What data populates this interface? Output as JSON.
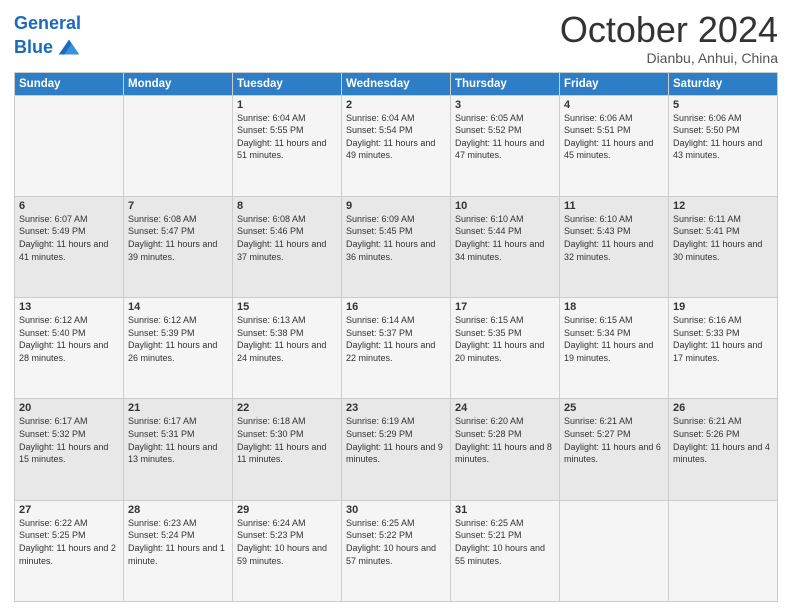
{
  "header": {
    "logo_line1": "General",
    "logo_line2": "Blue",
    "month": "October 2024",
    "location": "Dianbu, Anhui, China"
  },
  "weekdays": [
    "Sunday",
    "Monday",
    "Tuesday",
    "Wednesday",
    "Thursday",
    "Friday",
    "Saturday"
  ],
  "weeks": [
    [
      {
        "day": "",
        "sunrise": "",
        "sunset": "",
        "daylight": ""
      },
      {
        "day": "",
        "sunrise": "",
        "sunset": "",
        "daylight": ""
      },
      {
        "day": "1",
        "sunrise": "Sunrise: 6:04 AM",
        "sunset": "Sunset: 5:55 PM",
        "daylight": "Daylight: 11 hours and 51 minutes."
      },
      {
        "day": "2",
        "sunrise": "Sunrise: 6:04 AM",
        "sunset": "Sunset: 5:54 PM",
        "daylight": "Daylight: 11 hours and 49 minutes."
      },
      {
        "day": "3",
        "sunrise": "Sunrise: 6:05 AM",
        "sunset": "Sunset: 5:52 PM",
        "daylight": "Daylight: 11 hours and 47 minutes."
      },
      {
        "day": "4",
        "sunrise": "Sunrise: 6:06 AM",
        "sunset": "Sunset: 5:51 PM",
        "daylight": "Daylight: 11 hours and 45 minutes."
      },
      {
        "day": "5",
        "sunrise": "Sunrise: 6:06 AM",
        "sunset": "Sunset: 5:50 PM",
        "daylight": "Daylight: 11 hours and 43 minutes."
      }
    ],
    [
      {
        "day": "6",
        "sunrise": "Sunrise: 6:07 AM",
        "sunset": "Sunset: 5:49 PM",
        "daylight": "Daylight: 11 hours and 41 minutes."
      },
      {
        "day": "7",
        "sunrise": "Sunrise: 6:08 AM",
        "sunset": "Sunset: 5:47 PM",
        "daylight": "Daylight: 11 hours and 39 minutes."
      },
      {
        "day": "8",
        "sunrise": "Sunrise: 6:08 AM",
        "sunset": "Sunset: 5:46 PM",
        "daylight": "Daylight: 11 hours and 37 minutes."
      },
      {
        "day": "9",
        "sunrise": "Sunrise: 6:09 AM",
        "sunset": "Sunset: 5:45 PM",
        "daylight": "Daylight: 11 hours and 36 minutes."
      },
      {
        "day": "10",
        "sunrise": "Sunrise: 6:10 AM",
        "sunset": "Sunset: 5:44 PM",
        "daylight": "Daylight: 11 hours and 34 minutes."
      },
      {
        "day": "11",
        "sunrise": "Sunrise: 6:10 AM",
        "sunset": "Sunset: 5:43 PM",
        "daylight": "Daylight: 11 hours and 32 minutes."
      },
      {
        "day": "12",
        "sunrise": "Sunrise: 6:11 AM",
        "sunset": "Sunset: 5:41 PM",
        "daylight": "Daylight: 11 hours and 30 minutes."
      }
    ],
    [
      {
        "day": "13",
        "sunrise": "Sunrise: 6:12 AM",
        "sunset": "Sunset: 5:40 PM",
        "daylight": "Daylight: 11 hours and 28 minutes."
      },
      {
        "day": "14",
        "sunrise": "Sunrise: 6:12 AM",
        "sunset": "Sunset: 5:39 PM",
        "daylight": "Daylight: 11 hours and 26 minutes."
      },
      {
        "day": "15",
        "sunrise": "Sunrise: 6:13 AM",
        "sunset": "Sunset: 5:38 PM",
        "daylight": "Daylight: 11 hours and 24 minutes."
      },
      {
        "day": "16",
        "sunrise": "Sunrise: 6:14 AM",
        "sunset": "Sunset: 5:37 PM",
        "daylight": "Daylight: 11 hours and 22 minutes."
      },
      {
        "day": "17",
        "sunrise": "Sunrise: 6:15 AM",
        "sunset": "Sunset: 5:35 PM",
        "daylight": "Daylight: 11 hours and 20 minutes."
      },
      {
        "day": "18",
        "sunrise": "Sunrise: 6:15 AM",
        "sunset": "Sunset: 5:34 PM",
        "daylight": "Daylight: 11 hours and 19 minutes."
      },
      {
        "day": "19",
        "sunrise": "Sunrise: 6:16 AM",
        "sunset": "Sunset: 5:33 PM",
        "daylight": "Daylight: 11 hours and 17 minutes."
      }
    ],
    [
      {
        "day": "20",
        "sunrise": "Sunrise: 6:17 AM",
        "sunset": "Sunset: 5:32 PM",
        "daylight": "Daylight: 11 hours and 15 minutes."
      },
      {
        "day": "21",
        "sunrise": "Sunrise: 6:17 AM",
        "sunset": "Sunset: 5:31 PM",
        "daylight": "Daylight: 11 hours and 13 minutes."
      },
      {
        "day": "22",
        "sunrise": "Sunrise: 6:18 AM",
        "sunset": "Sunset: 5:30 PM",
        "daylight": "Daylight: 11 hours and 11 minutes."
      },
      {
        "day": "23",
        "sunrise": "Sunrise: 6:19 AM",
        "sunset": "Sunset: 5:29 PM",
        "daylight": "Daylight: 11 hours and 9 minutes."
      },
      {
        "day": "24",
        "sunrise": "Sunrise: 6:20 AM",
        "sunset": "Sunset: 5:28 PM",
        "daylight": "Daylight: 11 hours and 8 minutes."
      },
      {
        "day": "25",
        "sunrise": "Sunrise: 6:21 AM",
        "sunset": "Sunset: 5:27 PM",
        "daylight": "Daylight: 11 hours and 6 minutes."
      },
      {
        "day": "26",
        "sunrise": "Sunrise: 6:21 AM",
        "sunset": "Sunset: 5:26 PM",
        "daylight": "Daylight: 11 hours and 4 minutes."
      }
    ],
    [
      {
        "day": "27",
        "sunrise": "Sunrise: 6:22 AM",
        "sunset": "Sunset: 5:25 PM",
        "daylight": "Daylight: 11 hours and 2 minutes."
      },
      {
        "day": "28",
        "sunrise": "Sunrise: 6:23 AM",
        "sunset": "Sunset: 5:24 PM",
        "daylight": "Daylight: 11 hours and 1 minute."
      },
      {
        "day": "29",
        "sunrise": "Sunrise: 6:24 AM",
        "sunset": "Sunset: 5:23 PM",
        "daylight": "Daylight: 10 hours and 59 minutes."
      },
      {
        "day": "30",
        "sunrise": "Sunrise: 6:25 AM",
        "sunset": "Sunset: 5:22 PM",
        "daylight": "Daylight: 10 hours and 57 minutes."
      },
      {
        "day": "31",
        "sunrise": "Sunrise: 6:25 AM",
        "sunset": "Sunset: 5:21 PM",
        "daylight": "Daylight: 10 hours and 55 minutes."
      },
      {
        "day": "",
        "sunrise": "",
        "sunset": "",
        "daylight": ""
      },
      {
        "day": "",
        "sunrise": "",
        "sunset": "",
        "daylight": ""
      }
    ]
  ]
}
